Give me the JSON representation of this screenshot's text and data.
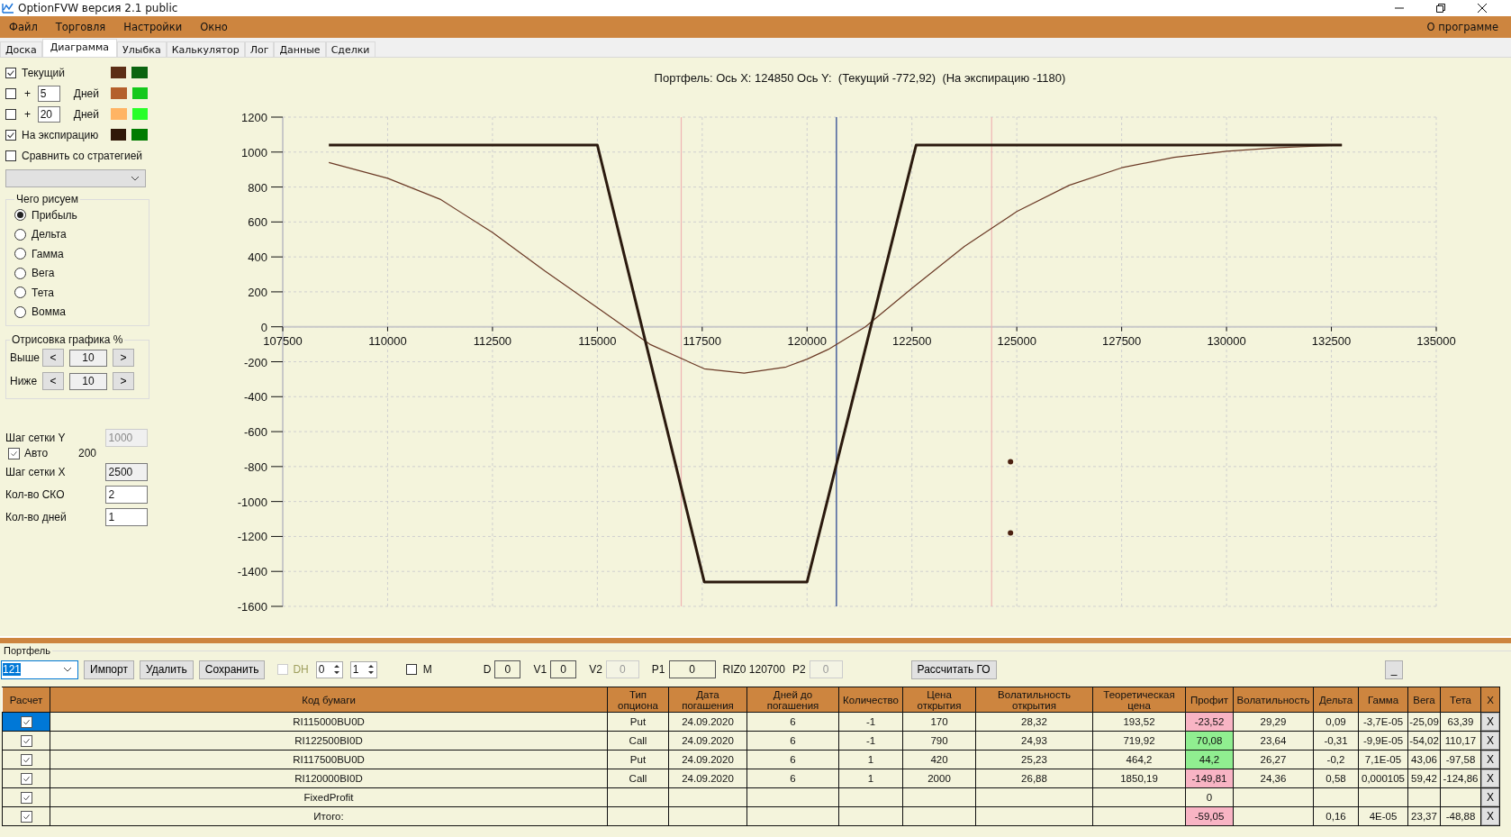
{
  "window": {
    "title": "OptionFVW версия 2.1 public"
  },
  "menu": {
    "items": [
      "Файл",
      "Торговля",
      "Настройки",
      "Окно"
    ],
    "right": "О программе"
  },
  "tabs": [
    {
      "label": "Доска",
      "selected": false
    },
    {
      "label": "Диаграмма",
      "selected": true
    },
    {
      "label": "Улыбка",
      "selected": false
    },
    {
      "label": "Калькулятор",
      "selected": false
    },
    {
      "label": "Лог",
      "selected": false
    },
    {
      "label": "Данные",
      "selected": false
    },
    {
      "label": "Сделки",
      "selected": false
    }
  ],
  "series_toggles": [
    {
      "kind": "plain",
      "label": "Текущий",
      "checked": true,
      "swatches": [
        {
          "color": "#5c2e16"
        },
        {
          "color": "#0b6410"
        }
      ]
    },
    {
      "kind": "days",
      "prefix": "+",
      "days": "5",
      "label": "Дней",
      "checked": false,
      "swatches": [
        {
          "color": "#b4602c"
        },
        {
          "color": "#14c81c"
        }
      ]
    },
    {
      "kind": "days",
      "prefix": "+",
      "days": "20",
      "label": "Дней",
      "checked": false,
      "swatches": [
        {
          "color": "#ffb464"
        },
        {
          "color": "#28ff28"
        }
      ]
    },
    {
      "kind": "plain",
      "label": "На экспирацию",
      "checked": true,
      "swatches": [
        {
          "color": "#301808"
        },
        {
          "color": "#007c00"
        }
      ]
    },
    {
      "kind": "plain",
      "label": "Сравнить со стратегией",
      "checked": false
    }
  ],
  "draw_group": {
    "title": "Чего рисуем",
    "options": [
      {
        "label": "Прибыль",
        "selected": true
      },
      {
        "label": "Дельта",
        "selected": false
      },
      {
        "label": "Гамма",
        "selected": false
      },
      {
        "label": "Вега",
        "selected": false
      },
      {
        "label": "Тета",
        "selected": false
      },
      {
        "label": "Вомма",
        "selected": false
      }
    ]
  },
  "range_group": {
    "title": "Отрисовка графика %",
    "rows": [
      {
        "label": "Выше",
        "value": "10",
        "dec": "<",
        "inc": ">"
      },
      {
        "label": "Ниже",
        "value": "10",
        "dec": "<",
        "inc": ">"
      }
    ]
  },
  "grid_settings": [
    {
      "kind": "input",
      "label": "Шаг сетки Y",
      "value": "1000",
      "disabled": true,
      "readonly": false
    },
    {
      "kind": "check",
      "label": "Авто",
      "checked": true,
      "value": "200"
    },
    {
      "kind": "input",
      "label": "Шаг сетки X",
      "value": "2500",
      "disabled": false,
      "readonly": true
    },
    {
      "kind": "input",
      "label": "Кол-во СКО",
      "value": "2",
      "disabled": false,
      "readonly": false
    },
    {
      "kind": "input",
      "label": "Кол-во дней",
      "value": "1",
      "disabled": false,
      "readonly": false
    }
  ],
  "chart": {
    "chart_data": {
      "type": "line",
      "title": "Портфель: Ось X: 124850 Ось Y:  (Текущий -772,92)  (На экспирацию -1180)",
      "grid": true,
      "x": [
        108600,
        110000,
        111250,
        112500,
        113750,
        115000,
        115650,
        116250,
        117500,
        117550,
        118500,
        119500,
        120000,
        120500,
        121390,
        122500,
        122600,
        123750,
        124850,
        125000,
        126250,
        127500,
        128750,
        130000,
        131250,
        132750
      ],
      "series": [
        {
          "color": "#6b3a26",
          "values": [
            940,
            850,
            730,
            540,
            320,
            110,
            0,
            -100,
            -235,
            -240,
            -265,
            -230,
            -185,
            -130,
            0,
            220,
            240,
            460,
            636,
            660,
            810,
            910,
            970,
            1005,
            1025,
            1040
          ]
        },
        {
          "color": "#2b1a0e",
          "values": [
            1040,
            1040,
            1040,
            1040,
            1040,
            1040,
            403,
            -185,
            -1411,
            -1460,
            -1460,
            -1460,
            -1460,
            -979,
            -124,
            944,
            1040,
            1040,
            1040,
            1040,
            1040,
            1040,
            1040,
            1040,
            1040,
            1040
          ]
        },
        {
          "color": "#4a2010",
          "marker": "o",
          "values": [
            null,
            null,
            null,
            null,
            null,
            null,
            null,
            null,
            null,
            null,
            null,
            null,
            null,
            null,
            null,
            null,
            null,
            null,
            -773,
            null,
            null,
            null,
            null,
            null,
            null,
            null
          ]
        },
        {
          "color": "#4a2010",
          "marker": "o",
          "values": [
            null,
            null,
            null,
            null,
            null,
            null,
            null,
            null,
            null,
            null,
            null,
            null,
            null,
            null,
            null,
            null,
            null,
            null,
            -1180,
            null,
            null,
            null,
            null,
            null,
            null,
            null
          ]
        }
      ],
      "xlim": [
        107500,
        135000
      ],
      "ylim": [
        -1600,
        1200
      ],
      "xticks": [
        107500,
        110000,
        112500,
        115000,
        117500,
        120000,
        122500,
        125000,
        127500,
        130000,
        132500,
        135000
      ],
      "yticks": [
        -1600,
        -1400,
        -1200,
        -1000,
        -800,
        -600,
        -400,
        -200,
        0,
        200,
        400,
        600,
        800,
        1000,
        1200
      ],
      "ref_lines": [
        {
          "axis": "x",
          "value": 117000,
          "color": "#f0b4b4"
        },
        {
          "axis": "x",
          "value": 124400,
          "color": "#f0b4b4"
        },
        {
          "axis": "x",
          "value": 120700,
          "color": "#1e3c8c"
        }
      ]
    }
  },
  "portfolio": {
    "title": "Портфель",
    "selector": "121",
    "buttons": [
      "Импорт",
      "Удалить",
      "Сохранить"
    ],
    "dh": {
      "label": "DH",
      "checked": false,
      "disabled": true
    },
    "spinners": [
      "0",
      "1"
    ],
    "m": {
      "label": "M",
      "checked": false
    },
    "fields": [
      {
        "label": "D",
        "value": "0",
        "disabled": false
      },
      {
        "label": "V1",
        "value": "0",
        "disabled": false
      },
      {
        "label": "V2",
        "value": "0",
        "disabled": true
      },
      {
        "label": "P1",
        "value": "0",
        "disabled": false,
        "suffix": "RIZ0 120700"
      },
      {
        "label": "P2",
        "value": "0",
        "disabled": true
      }
    ],
    "calc_button": "Рассчитать ГО",
    "collapse_button": "_"
  },
  "table": {
    "columns": [
      {
        "label": "Расчет",
        "kind": "check"
      },
      {
        "label": "Код бумаги",
        "kind": "text"
      },
      {
        "label": "Тип опциона",
        "kind": "text"
      },
      {
        "label": "Дата погашения",
        "kind": "text"
      },
      {
        "label": "Дней до погашения",
        "kind": "text"
      },
      {
        "label": "Количество",
        "kind": "text"
      },
      {
        "label": "Цена открытия",
        "kind": "text"
      },
      {
        "label": "Волатильность открытия",
        "kind": "text"
      },
      {
        "label": "Теоретическая цена",
        "kind": "text"
      },
      {
        "label": "Профит",
        "kind": "profit"
      },
      {
        "label": "Волатильность",
        "kind": "text"
      },
      {
        "label": "Дельта",
        "kind": "text"
      },
      {
        "label": "Гамма",
        "kind": "text"
      },
      {
        "label": "Вега",
        "kind": "text"
      },
      {
        "label": "Тета",
        "kind": "text"
      },
      {
        "label": "X",
        "kind": "remove"
      }
    ],
    "rows": [
      {
        "selected": true,
        "checked": true,
        "cells": [
          null,
          "RI115000BU0D",
          "Put",
          "24.09.2020",
          "6",
          "-1",
          "170",
          "28,32",
          "193,52",
          {
            "text": "-23,52",
            "color": "#f8b4c4"
          },
          "29,29",
          "0,09",
          "-3,7E-05",
          "-25,09",
          "63,39",
          "X"
        ]
      },
      {
        "selected": false,
        "checked": true,
        "cells": [
          null,
          "RI122500BI0D",
          "Call",
          "24.09.2020",
          "6",
          "-1",
          "790",
          "24,93",
          "719,92",
          {
            "text": "70,08",
            "color": "#90ee90"
          },
          "23,64",
          "-0,31",
          "-9,9E-05",
          "-54,02",
          "110,17",
          "X"
        ]
      },
      {
        "selected": false,
        "checked": true,
        "cells": [
          null,
          "RI117500BU0D",
          "Put",
          "24.09.2020",
          "6",
          "1",
          "420",
          "25,23",
          "464,2",
          {
            "text": "44,2",
            "color": "#90ee90"
          },
          "26,27",
          "-0,2",
          "7,1E-05",
          "43,06",
          "-97,58",
          "X"
        ]
      },
      {
        "selected": false,
        "checked": true,
        "cells": [
          null,
          "RI120000BI0D",
          "Call",
          "24.09.2020",
          "6",
          "1",
          "2000",
          "26,88",
          "1850,19",
          {
            "text": "-149,81",
            "color": "#f8b4c4"
          },
          "24,36",
          "0,58",
          "0,000105",
          "59,42",
          "-124,86",
          "X"
        ]
      },
      {
        "selected": false,
        "checked": true,
        "cells": [
          null,
          "FixedProfit",
          null,
          null,
          null,
          null,
          null,
          null,
          null,
          {
            "text": "0"
          },
          null,
          null,
          null,
          null,
          null,
          "X"
        ]
      },
      {
        "selected": false,
        "checked": true,
        "cells": [
          null,
          "Итого:",
          null,
          null,
          null,
          null,
          null,
          null,
          null,
          {
            "text": "-59,05",
            "color": "#f8b4c4"
          },
          null,
          "0,16",
          "4E-05",
          "23,37",
          "-48,88",
          "X"
        ]
      }
    ]
  }
}
